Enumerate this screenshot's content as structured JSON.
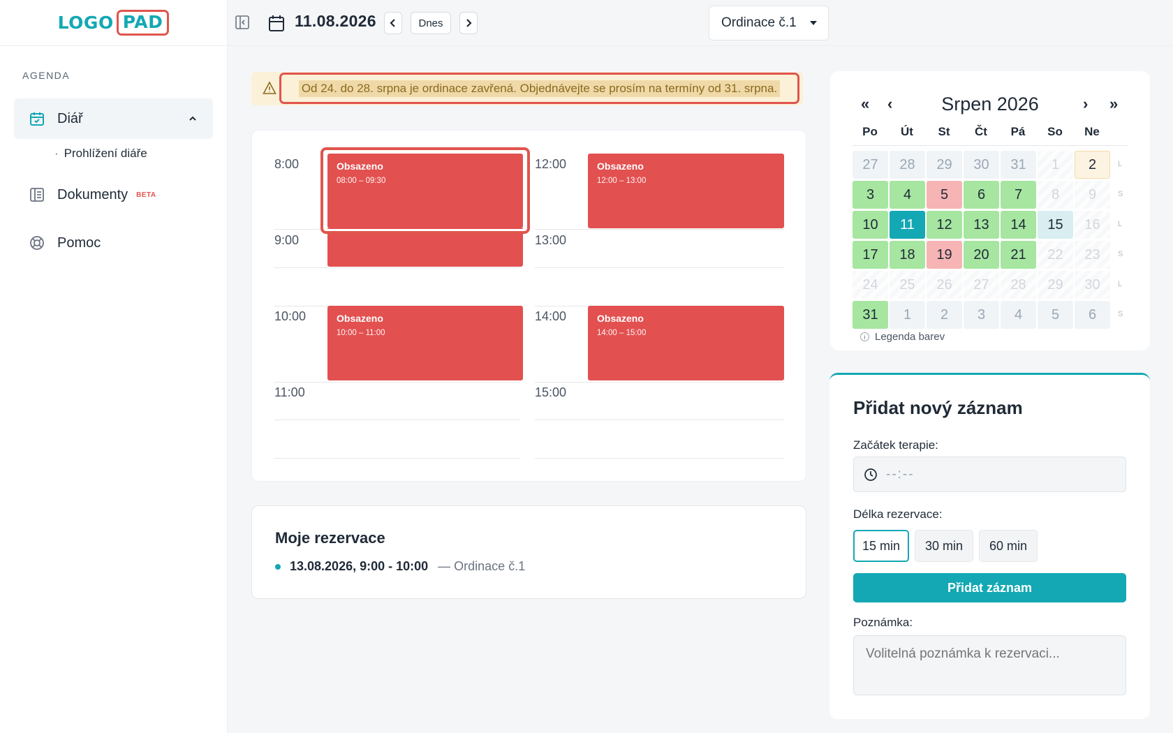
{
  "logo": {
    "part1": "LOGO",
    "part2": "PAD"
  },
  "sidebar": {
    "section": "AGENDA",
    "items": [
      {
        "label": "Diář",
        "icon": "calendar-check-icon",
        "active": true,
        "sub": [
          "Prohlížení diáře"
        ]
      },
      {
        "label": "Dokumenty",
        "icon": "document-icon",
        "badge": "BETA"
      },
      {
        "label": "Pomoc",
        "icon": "lifebuoy-icon"
      }
    ]
  },
  "topbar": {
    "date": "11.08.2026",
    "today": "Dnes",
    "office": "Ordinace č.1"
  },
  "notice": "Od 24. do 28. srpna je ordinace zavřená. Objednávejte se prosím na termíny od 31. srpna.",
  "schedule": {
    "slots": [
      "8:00",
      "9:00",
      "10:00",
      "11:00",
      "12:00",
      "13:00",
      "14:00",
      "15:00"
    ],
    "events": [
      {
        "title": "Obsazeno",
        "range": "08:00 – 09:30"
      },
      {
        "title": "Obsazeno",
        "range": "10:00 – 11:00"
      },
      {
        "title": "Obsazeno",
        "range": "12:00 – 13:00"
      },
      {
        "title": "Obsazeno",
        "range": "14:00 – 15:00"
      }
    ]
  },
  "reservations": {
    "title": "Moje rezervace",
    "items": [
      {
        "when": "13.08.2026, 9:00 - 10:00",
        "where": "— Ordinace č.1"
      }
    ]
  },
  "calendar": {
    "title": "Srpen 2026",
    "nav": {
      "prev_year": "«",
      "prev": "‹",
      "next": "›",
      "next_year": "»"
    },
    "weekdays": [
      "Po",
      "Út",
      "St",
      "Čt",
      "Pá",
      "So",
      "Ne"
    ],
    "weeks": [
      {
        "days": [
          "27",
          "28",
          "29",
          "30",
          "31",
          "1",
          "2"
        ],
        "mark": "L"
      },
      {
        "days": [
          "3",
          "4",
          "5",
          "6",
          "7",
          "8",
          "9"
        ],
        "mark": "S"
      },
      {
        "days": [
          "10",
          "11",
          "12",
          "13",
          "14",
          "15",
          "16"
        ],
        "mark": "L"
      },
      {
        "days": [
          "17",
          "18",
          "19",
          "20",
          "21",
          "22",
          "23"
        ],
        "mark": "S"
      },
      {
        "days": [
          "24",
          "25",
          "26",
          "27",
          "28",
          "29",
          "30"
        ],
        "mark": "L"
      },
      {
        "days": [
          "31",
          "1",
          "2",
          "3",
          "4",
          "5",
          "6"
        ],
        "mark": "S"
      }
    ],
    "states": [
      [
        "other",
        "other",
        "other",
        "other",
        "other",
        "dis",
        "hol"
      ],
      [
        "avail",
        "avail",
        "busy",
        "avail",
        "avail",
        "dis",
        "dis"
      ],
      [
        "avail",
        "sel",
        "avail",
        "avail",
        "avail",
        "blue",
        "dis"
      ],
      [
        "avail",
        "avail",
        "busy",
        "avail",
        "avail",
        "dis",
        "dis"
      ],
      [
        "dis",
        "dis",
        "dis",
        "dis",
        "dis",
        "dis",
        "dis"
      ],
      [
        "avail",
        "other",
        "other",
        "other",
        "other",
        "other",
        "other"
      ]
    ],
    "legend": "Legenda barev",
    "colors": {
      "available": "#a6e6a0",
      "busy": "#f6b4b4",
      "selected": "#13a8b4",
      "holiday": "#fdf3e3"
    }
  },
  "form": {
    "title": "Přidat nový záznam",
    "start_label": "Začátek terapie:",
    "start_placeholder": "--:--",
    "duration_label": "Délka rezervace:",
    "durations": [
      "15 min",
      "30 min",
      "60 min"
    ],
    "submit": "Přidat záznam",
    "note_label": "Poznámka:",
    "note_placeholder": "Volitelná poznámka k rezervaci..."
  },
  "colors": {
    "accent": "#13a8b4",
    "danger": "#e25050",
    "highlight": "#e0554d"
  }
}
